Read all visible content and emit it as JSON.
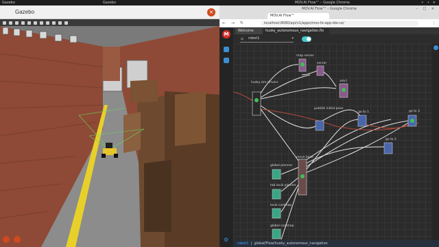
{
  "desktop": {
    "left_title": "Gazebo",
    "center_title": "Gazebo",
    "right_title": "MOV.AI Flow™ – Google Chrome",
    "system_tray": "• • ▾"
  },
  "gazebo": {
    "title": "Gazebo",
    "close": "×"
  },
  "chrome": {
    "window_title": "MOV.AI Flow™ – Google Chrome",
    "window_controls": "– □ ×",
    "tab_label": "MOV.AI Flow™",
    "nav": "← → ↻",
    "url": "localhost:8080/api/v1/apps/mov-fe-app-ide-ce/",
    "menu": "⋮"
  },
  "app": {
    "logo": "M",
    "tabs": [
      "Welcome",
      "husky_autonomous_navigation.flo"
    ],
    "robot_select": "robot1",
    "robot_icon": "⌂",
    "dropdown_caret": "▾",
    "settings_icon": "⚙",
    "status": {
      "robot": "robot1",
      "path": "global/Flow/husky_autonomous_navigation"
    }
  },
  "nodes": [
    {
      "id": "husky_sim_drivers",
      "label": "husky sim drivers",
      "kind": "dark"
    },
    {
      "id": "map_server",
      "label": "map server",
      "kind": "purple"
    },
    {
      "id": "server",
      "label": "server",
      "kind": "purple"
    },
    {
      "id": "amcl",
      "label": "amcl",
      "kind": "purple"
    },
    {
      "id": "publish_initial_pose",
      "label": "publish initial pose",
      "kind": "blue"
    },
    {
      "id": "goal1",
      "label": "go to 1",
      "kind": "blue"
    },
    {
      "id": "goal2",
      "label": "go to 2",
      "kind": "blue"
    },
    {
      "id": "goal3",
      "label": "go to 3",
      "kind": "blue"
    },
    {
      "id": "move_base",
      "label": "move base",
      "kind": "dark"
    },
    {
      "id": "global_planner",
      "label": "global planner",
      "kind": "green"
    },
    {
      "id": "tab_local_planner",
      "label": "tab local planner",
      "kind": "green"
    },
    {
      "id": "local_costmap",
      "label": "local costmap",
      "kind": "green"
    },
    {
      "id": "global_costmap",
      "label": "global costmap",
      "kind": "green"
    }
  ],
  "colors": {
    "accent": "#46c8d0",
    "brand": "#d9312b",
    "node_green": "#3aa584",
    "node_blue": "#4a66a8",
    "node_purple": "#8a5a8a",
    "link": "#e6e6e6",
    "link_red": "#b54a3a"
  }
}
